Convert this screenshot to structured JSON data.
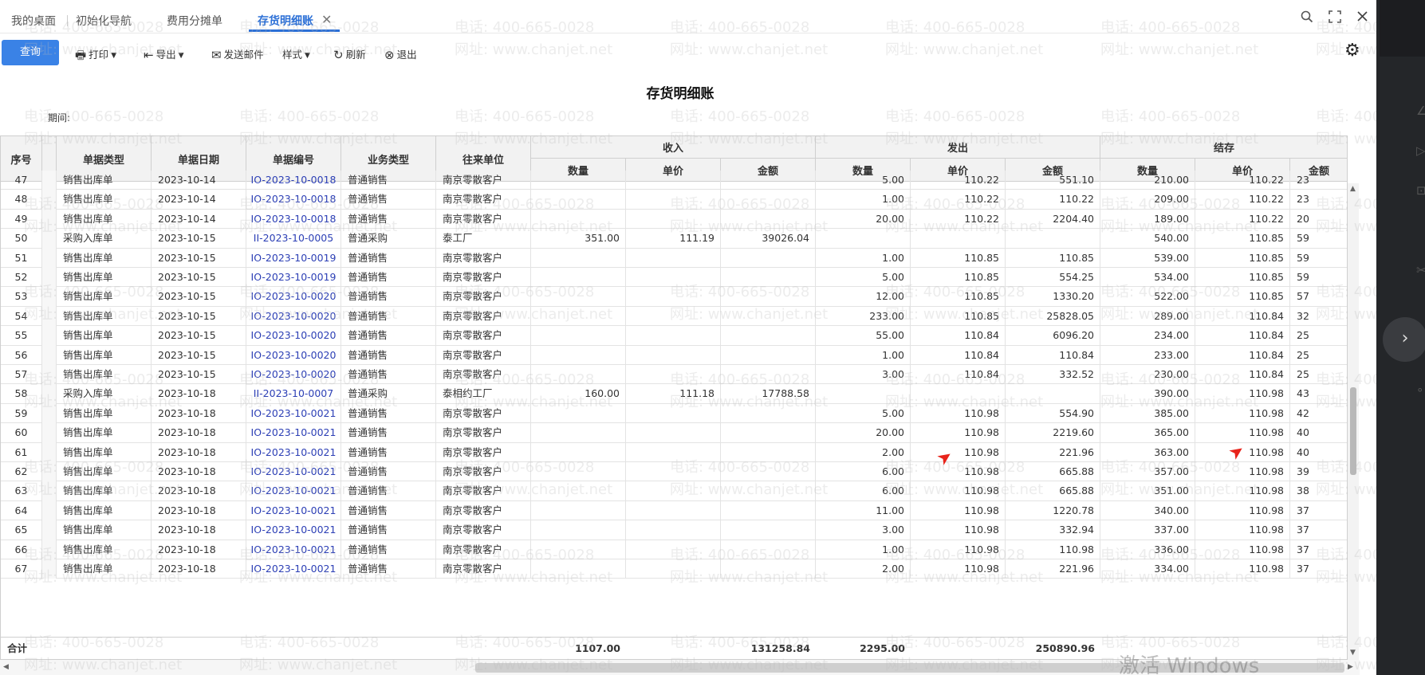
{
  "tabs": [
    {
      "label": "我的桌面",
      "active": false
    },
    {
      "label": "初始化导航",
      "active": false
    },
    {
      "label": "费用分摊单",
      "active": false
    },
    {
      "label": "存货明细账",
      "active": true
    }
  ],
  "header_icons": [
    "search-icon",
    "fullscreen-icon",
    "close-icon"
  ],
  "toolbar": {
    "query": "查询",
    "print": "打印",
    "export": "导出",
    "send_mail": "发送邮件",
    "style": "样式",
    "refresh": "刷新",
    "exit": "退出"
  },
  "report": {
    "title": "存货明细账",
    "period_label": "期间:"
  },
  "columns": {
    "seq": "序号",
    "doc_type": "单据类型",
    "doc_date": "单据日期",
    "doc_no": "单据编号",
    "biz_type": "业务类型",
    "partner": "往来单位",
    "group_in": "收入",
    "group_out": "发出",
    "group_bal": "结存",
    "qty": "数量",
    "price": "单价",
    "amount": "金额"
  },
  "rows": [
    {
      "seq": "47",
      "type": "销售出库单",
      "date": "2023-10-14",
      "no": "IO-2023-10-0018",
      "biz": "普通销售",
      "partner": "南京零散客户",
      "in_qty": "",
      "in_price": "",
      "in_amt": "",
      "out_qty": "5.00",
      "out_price": "110.22",
      "out_amt": "551.10",
      "bal_qty": "210.00",
      "bal_price": "110.22",
      "bal_amt": "23"
    },
    {
      "seq": "48",
      "type": "销售出库单",
      "date": "2023-10-14",
      "no": "IO-2023-10-0018",
      "biz": "普通销售",
      "partner": "南京零散客户",
      "in_qty": "",
      "in_price": "",
      "in_amt": "",
      "out_qty": "1.00",
      "out_price": "110.22",
      "out_amt": "110.22",
      "bal_qty": "209.00",
      "bal_price": "110.22",
      "bal_amt": "23"
    },
    {
      "seq": "49",
      "type": "销售出库单",
      "date": "2023-10-14",
      "no": "IO-2023-10-0018",
      "biz": "普通销售",
      "partner": "南京零散客户",
      "in_qty": "",
      "in_price": "",
      "in_amt": "",
      "out_qty": "20.00",
      "out_price": "110.22",
      "out_amt": "2204.40",
      "bal_qty": "189.00",
      "bal_price": "110.22",
      "bal_amt": "20"
    },
    {
      "seq": "50",
      "type": "采购入库单",
      "date": "2023-10-15",
      "no": "II-2023-10-0005",
      "biz": "普通采购",
      "partner": "泰工厂",
      "in_qty": "351.00",
      "in_price": "111.19",
      "in_amt": "39026.04",
      "out_qty": "",
      "out_price": "",
      "out_amt": "",
      "bal_qty": "540.00",
      "bal_price": "110.85",
      "bal_amt": "59"
    },
    {
      "seq": "51",
      "type": "销售出库单",
      "date": "2023-10-15",
      "no": "IO-2023-10-0019",
      "biz": "普通销售",
      "partner": "南京零散客户",
      "in_qty": "",
      "in_price": "",
      "in_amt": "",
      "out_qty": "1.00",
      "out_price": "110.85",
      "out_amt": "110.85",
      "bal_qty": "539.00",
      "bal_price": "110.85",
      "bal_amt": "59"
    },
    {
      "seq": "52",
      "type": "销售出库单",
      "date": "2023-10-15",
      "no": "IO-2023-10-0019",
      "biz": "普通销售",
      "partner": "南京零散客户",
      "in_qty": "",
      "in_price": "",
      "in_amt": "",
      "out_qty": "5.00",
      "out_price": "110.85",
      "out_amt": "554.25",
      "bal_qty": "534.00",
      "bal_price": "110.85",
      "bal_amt": "59"
    },
    {
      "seq": "53",
      "type": "销售出库单",
      "date": "2023-10-15",
      "no": "IO-2023-10-0020",
      "biz": "普通销售",
      "partner": "南京零散客户",
      "in_qty": "",
      "in_price": "",
      "in_amt": "",
      "out_qty": "12.00",
      "out_price": "110.85",
      "out_amt": "1330.20",
      "bal_qty": "522.00",
      "bal_price": "110.85",
      "bal_amt": "57"
    },
    {
      "seq": "54",
      "type": "销售出库单",
      "date": "2023-10-15",
      "no": "IO-2023-10-0020",
      "biz": "普通销售",
      "partner": "南京零散客户",
      "in_qty": "",
      "in_price": "",
      "in_amt": "",
      "out_qty": "233.00",
      "out_price": "110.85",
      "out_amt": "25828.05",
      "bal_qty": "289.00",
      "bal_price": "110.84",
      "bal_amt": "32"
    },
    {
      "seq": "55",
      "type": "销售出库单",
      "date": "2023-10-15",
      "no": "IO-2023-10-0020",
      "biz": "普通销售",
      "partner": "南京零散客户",
      "in_qty": "",
      "in_price": "",
      "in_amt": "",
      "out_qty": "55.00",
      "out_price": "110.84",
      "out_amt": "6096.20",
      "bal_qty": "234.00",
      "bal_price": "110.84",
      "bal_amt": "25"
    },
    {
      "seq": "56",
      "type": "销售出库单",
      "date": "2023-10-15",
      "no": "IO-2023-10-0020",
      "biz": "普通销售",
      "partner": "南京零散客户",
      "in_qty": "",
      "in_price": "",
      "in_amt": "",
      "out_qty": "1.00",
      "out_price": "110.84",
      "out_amt": "110.84",
      "bal_qty": "233.00",
      "bal_price": "110.84",
      "bal_amt": "25"
    },
    {
      "seq": "57",
      "type": "销售出库单",
      "date": "2023-10-15",
      "no": "IO-2023-10-0020",
      "biz": "普通销售",
      "partner": "南京零散客户",
      "in_qty": "",
      "in_price": "",
      "in_amt": "",
      "out_qty": "3.00",
      "out_price": "110.84",
      "out_amt": "332.52",
      "bal_qty": "230.00",
      "bal_price": "110.84",
      "bal_amt": "25"
    },
    {
      "seq": "58",
      "type": "采购入库单",
      "date": "2023-10-18",
      "no": "II-2023-10-0007",
      "biz": "普通采购",
      "partner": "泰相约工厂",
      "in_qty": "160.00",
      "in_price": "111.18",
      "in_amt": "17788.58",
      "out_qty": "",
      "out_price": "",
      "out_amt": "",
      "bal_qty": "390.00",
      "bal_price": "110.98",
      "bal_amt": "43"
    },
    {
      "seq": "59",
      "type": "销售出库单",
      "date": "2023-10-18",
      "no": "IO-2023-10-0021",
      "biz": "普通销售",
      "partner": "南京零散客户",
      "in_qty": "",
      "in_price": "",
      "in_amt": "",
      "out_qty": "5.00",
      "out_price": "110.98",
      "out_amt": "554.90",
      "bal_qty": "385.00",
      "bal_price": "110.98",
      "bal_amt": "42"
    },
    {
      "seq": "60",
      "type": "销售出库单",
      "date": "2023-10-18",
      "no": "IO-2023-10-0021",
      "biz": "普通销售",
      "partner": "南京零散客户",
      "in_qty": "",
      "in_price": "",
      "in_amt": "",
      "out_qty": "20.00",
      "out_price": "110.98",
      "out_amt": "2219.60",
      "bal_qty": "365.00",
      "bal_price": "110.98",
      "bal_amt": "40"
    },
    {
      "seq": "61",
      "type": "销售出库单",
      "date": "2023-10-18",
      "no": "IO-2023-10-0021",
      "biz": "普通销售",
      "partner": "南京零散客户",
      "in_qty": "",
      "in_price": "",
      "in_amt": "",
      "out_qty": "2.00",
      "out_price": "110.98",
      "out_amt": "221.96",
      "bal_qty": "363.00",
      "bal_price": "110.98",
      "bal_amt": "40"
    },
    {
      "seq": "62",
      "type": "销售出库单",
      "date": "2023-10-18",
      "no": "IO-2023-10-0021",
      "biz": "普通销售",
      "partner": "南京零散客户",
      "in_qty": "",
      "in_price": "",
      "in_amt": "",
      "out_qty": "6.00",
      "out_price": "110.98",
      "out_amt": "665.88",
      "bal_qty": "357.00",
      "bal_price": "110.98",
      "bal_amt": "39"
    },
    {
      "seq": "63",
      "type": "销售出库单",
      "date": "2023-10-18",
      "no": "IO-2023-10-0021",
      "biz": "普通销售",
      "partner": "南京零散客户",
      "in_qty": "",
      "in_price": "",
      "in_amt": "",
      "out_qty": "6.00",
      "out_price": "110.98",
      "out_amt": "665.88",
      "bal_qty": "351.00",
      "bal_price": "110.98",
      "bal_amt": "38"
    },
    {
      "seq": "64",
      "type": "销售出库单",
      "date": "2023-10-18",
      "no": "IO-2023-10-0021",
      "biz": "普通销售",
      "partner": "南京零散客户",
      "in_qty": "",
      "in_price": "",
      "in_amt": "",
      "out_qty": "11.00",
      "out_price": "110.98",
      "out_amt": "1220.78",
      "bal_qty": "340.00",
      "bal_price": "110.98",
      "bal_amt": "37"
    },
    {
      "seq": "65",
      "type": "销售出库单",
      "date": "2023-10-18",
      "no": "IO-2023-10-0021",
      "biz": "普通销售",
      "partner": "南京零散客户",
      "in_qty": "",
      "in_price": "",
      "in_amt": "",
      "out_qty": "3.00",
      "out_price": "110.98",
      "out_amt": "332.94",
      "bal_qty": "337.00",
      "bal_price": "110.98",
      "bal_amt": "37"
    },
    {
      "seq": "66",
      "type": "销售出库单",
      "date": "2023-10-18",
      "no": "IO-2023-10-0021",
      "biz": "普通销售",
      "partner": "南京零散客户",
      "in_qty": "",
      "in_price": "",
      "in_amt": "",
      "out_qty": "1.00",
      "out_price": "110.98",
      "out_amt": "110.98",
      "bal_qty": "336.00",
      "bal_price": "110.98",
      "bal_amt": "37"
    },
    {
      "seq": "67",
      "type": "销售出库单",
      "date": "2023-10-18",
      "no": "IO-2023-10-0021",
      "biz": "普通销售",
      "partner": "南京零散客户",
      "in_qty": "",
      "in_price": "",
      "in_amt": "",
      "out_qty": "2.00",
      "out_price": "110.98",
      "out_amt": "221.96",
      "bal_qty": "334.00",
      "bal_price": "110.98",
      "bal_amt": "37"
    }
  ],
  "totals": {
    "label": "合计",
    "in_qty": "1107.00",
    "in_amt": "131258.84",
    "out_qty": "2295.00",
    "out_amt": "250890.96"
  },
  "watermark": {
    "phone": "电话: 400-665-0028",
    "site": "网址: www.chanjet.net"
  },
  "windows_watermark": "激活 Windows",
  "colors": {
    "accent": "#2b6fd6",
    "query_button": "#3a82e6",
    "link": "#2c3fb5",
    "annotation_arrow": "#e8231a",
    "side_panel": "#242629"
  }
}
